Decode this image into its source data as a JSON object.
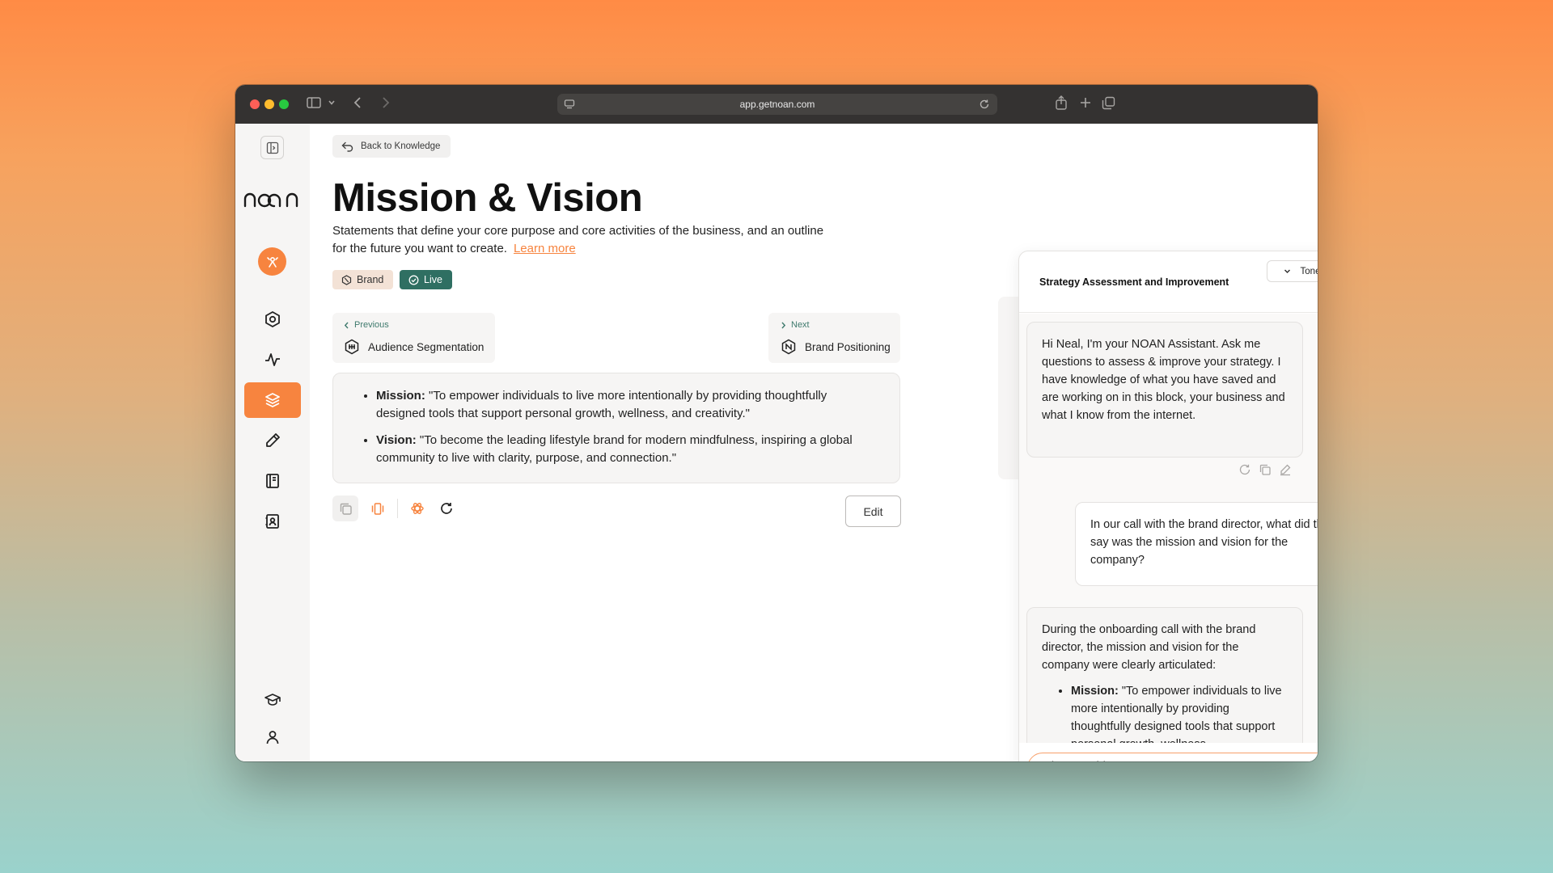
{
  "browser": {
    "url": "app.getnoan.com",
    "traffic_light_colors": [
      "#fe5f57",
      "#febc2e",
      "#28c840"
    ]
  },
  "sidebar": {
    "logo": "noan",
    "items": [
      {
        "icon": "hexagon-gear-icon"
      },
      {
        "icon": "activity-icon"
      },
      {
        "icon": "layers-icon",
        "active": true
      },
      {
        "icon": "pencil-icon"
      },
      {
        "icon": "book-icon"
      },
      {
        "icon": "contacts-icon"
      }
    ],
    "bottom_items": [
      {
        "icon": "graduation-cap-icon"
      },
      {
        "icon": "user-icon"
      }
    ]
  },
  "main": {
    "back_label": "Back to Knowledge",
    "title": "Mission & Vision",
    "description": "Statements that define your core purpose and core activities of the business, and an outline for the future you want to create.",
    "learn_more": "Learn more",
    "tags": {
      "brand": "Brand",
      "live": "Live"
    },
    "previous": {
      "label": "Previous",
      "name": "Audience Segmentation"
    },
    "next": {
      "label": "Next",
      "name": "Brand Positioning"
    },
    "content": [
      {
        "label": "Mission:",
        "text": " \"To empower individuals to live more intentionally by providing thoughtfully designed tools that support personal growth, wellness, and creativity.\""
      },
      {
        "label": "Vision:",
        "text": " \"To become the leading lifestyle brand for modern mindfulness, inspiring a global community to live with clarity, purpose, and connection.\""
      }
    ],
    "edit_label": "Edit",
    "accent_color": "#f7843f",
    "live_color": "#2f6f62"
  },
  "chat": {
    "title": "Strategy Assessment and Improvement",
    "tone_label": "Tone",
    "messages": {
      "assistant_1": "Hi Neal, I'm your NOAN Assistant. Ask me questions to assess & improve your strategy. I have knowledge of what you have saved and are working on in this block, your business and what I know from the internet.",
      "user_1": "In our call with the brand director, what did they say was the mission and vision for the company?",
      "assistant_2_intro": "During the onboarding call with the brand director, the mission and vision for the company were clearly articulated:",
      "assistant_2_mission_label": "Mission:",
      "assistant_2_mission_text": " \"To empower individuals to live more intentionally by providing thoughtfully designed tools that support personal growth, wellness"
    },
    "input_placeholder": "Ask AI anything..."
  }
}
